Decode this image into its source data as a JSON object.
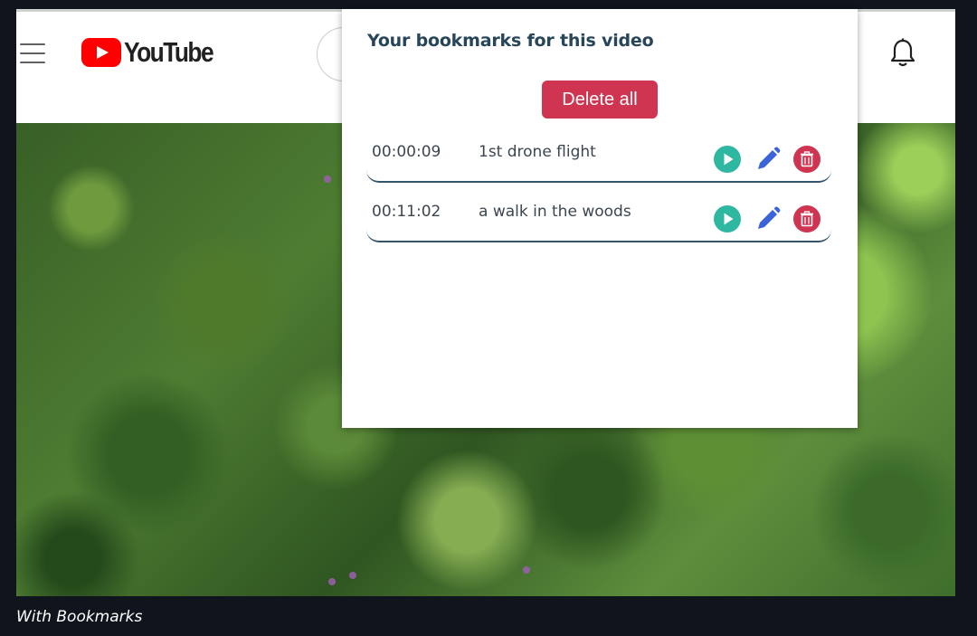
{
  "youtube_header": {
    "logo_text": "YouTube",
    "icons": {
      "menu": "hamburger-menu-icon",
      "logo": "youtube-play-icon",
      "notifications": "bell-icon"
    }
  },
  "bookmarks_popup": {
    "title": "Your bookmarks for this video",
    "delete_all_label": "Delete all",
    "bookmarks": [
      {
        "time": "00:00:09",
        "title": "1st drone flight"
      },
      {
        "time": "00:11:02",
        "title": "a walk in the woods"
      }
    ],
    "action_icons": [
      "play-icon",
      "edit-pencil-icon",
      "trash-icon"
    ]
  },
  "caption": "With Bookmarks",
  "colors": {
    "accent_teal": "#2eb8a2",
    "edit_blue": "#3a64d8",
    "delete_red": "#cf3550",
    "title_text": "#27465a",
    "row_divider": "#33546b",
    "page_background": "#10141d"
  }
}
